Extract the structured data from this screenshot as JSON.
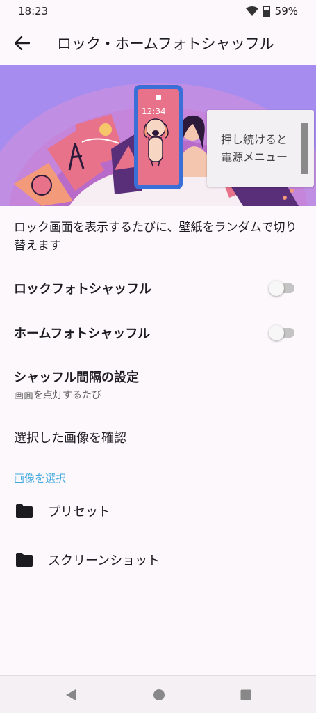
{
  "status_bar": {
    "time": "18:23",
    "battery": "59%"
  },
  "app_bar": {
    "title": "ロック・ホームフォトシャッフル"
  },
  "hero": {
    "tooltip_line1": "押し続けると",
    "tooltip_line2": "電源メニュー",
    "phone_time": "12:34"
  },
  "description": "ロック画面を表示するたびに、壁紙をランダムで切り替えます",
  "settings": {
    "lock_shuffle": {
      "label": "ロックフォトシャッフル",
      "enabled": false
    },
    "home_shuffle": {
      "label": "ホームフォトシャッフル",
      "enabled": false
    },
    "interval": {
      "label": "シャッフル間隔の設定",
      "value": "画面を点灯するたび"
    },
    "confirm": {
      "label": "選択した画像を確認"
    }
  },
  "image_section": {
    "header": "画像を選択",
    "folders": [
      {
        "label": "プリセット",
        "icon": "folder-icon"
      },
      {
        "label": "スクリーンショット",
        "icon": "folder-icon"
      }
    ]
  },
  "colors": {
    "accent": "#3fa9df",
    "hero_bg": "#a78cf0",
    "background": "#fdf8fc"
  }
}
